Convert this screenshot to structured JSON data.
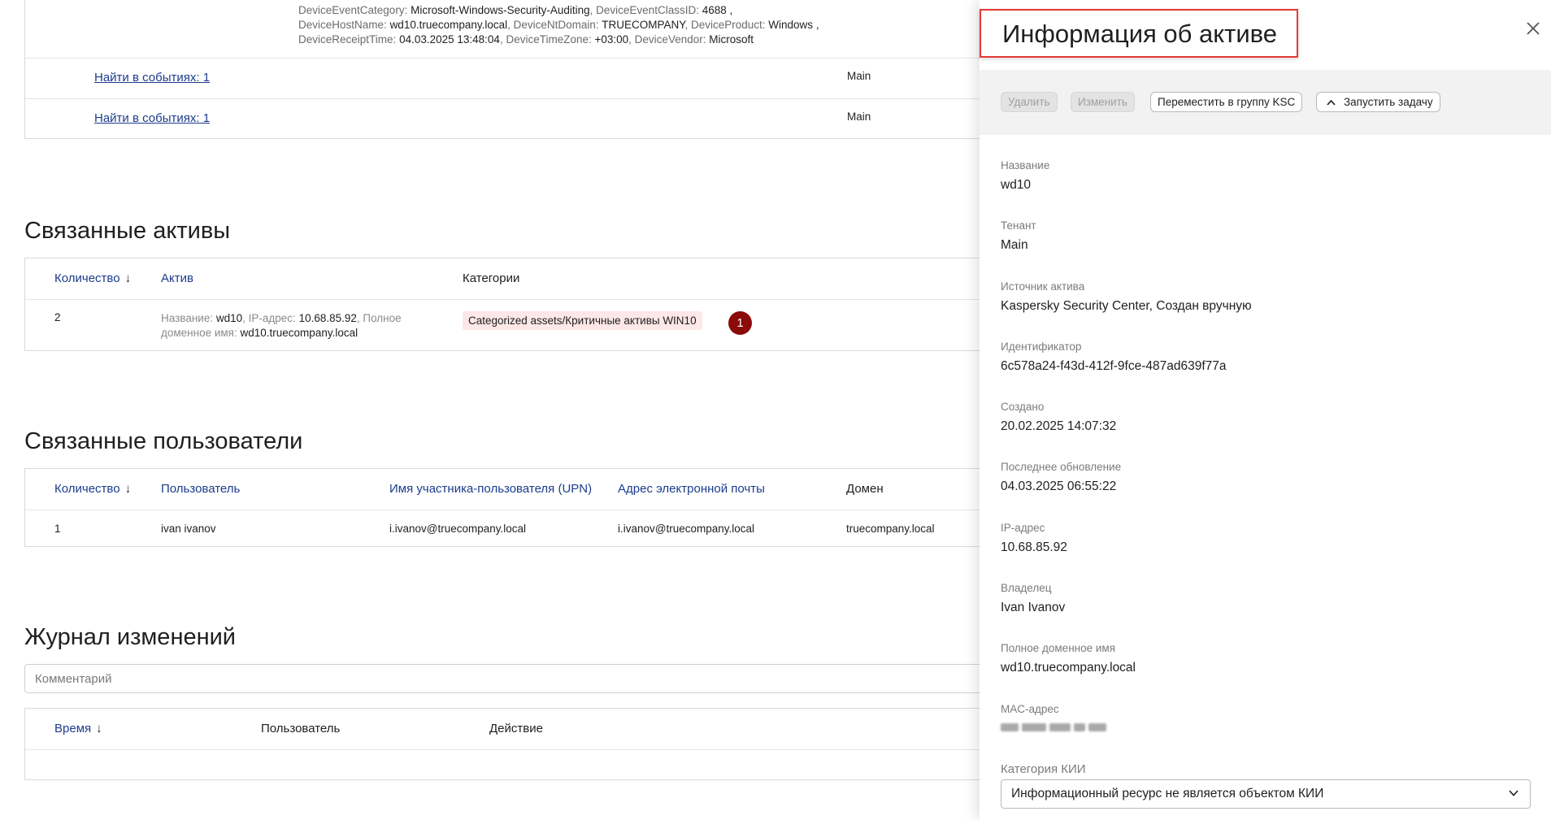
{
  "event_fields": {
    "line1": {
      "k1": "DeviceEventCategory:",
      "v1": "Microsoft-Windows-Security-Auditing",
      "k2": ", DeviceEventClassID:",
      "v2": "4688",
      "end": ","
    },
    "line2": {
      "k1": "DeviceHostName:",
      "v1": "wd10.truecompany.local",
      "k2": ", DeviceNtDomain:",
      "v2": "TRUECOMPANY",
      "k3": ", DeviceProduct:",
      "v3": "Windows",
      "end": ","
    },
    "line3": {
      "k1": "DeviceReceiptTime:",
      "v1": "04.03.2025 13:48:04",
      "k2": ", DeviceTimeZone:",
      "v2": "+03:00",
      "k3": ", DeviceVendor:",
      "v3": "Microsoft"
    }
  },
  "event_links": [
    {
      "link": "Найти в событиях: 1",
      "tenant": "Main"
    },
    {
      "link": "Найти в событиях: 1",
      "tenant": "Main"
    }
  ],
  "related_assets": {
    "title": "Связанные активы",
    "headers": {
      "count": "Количество",
      "asset": "Актив",
      "categories": "Категории"
    },
    "rows": [
      {
        "count": "2",
        "name_label": "Название:",
        "name": "wd10",
        "ip_label": ", IP-адрес:",
        "ip": "10.68.85.92",
        "fqdn_label_1": ", Полное",
        "fqdn_label_2": "доменное имя:",
        "fqdn": "wd10.truecompany.local",
        "category": "Categorized assets/Критичные активы WIN10",
        "badge": "1"
      }
    ]
  },
  "related_users": {
    "title": "Связанные пользователи",
    "headers": {
      "count": "Количество",
      "user": "Пользователь",
      "upn": "Имя участника-пользователя (UPN)",
      "email": "Адрес электронной почты",
      "domain": "Домен"
    },
    "rows": [
      {
        "count": "1",
        "user": "ivan ivanov",
        "upn": "i.ivanov@truecompany.local",
        "email": "i.ivanov@truecompany.local",
        "domain": "truecompany.local"
      }
    ]
  },
  "changelog": {
    "title": "Журнал изменений",
    "comment_placeholder": "Комментарий",
    "headers": {
      "time": "Время",
      "user": "Пользователь",
      "action": "Действие"
    }
  },
  "drawer": {
    "title": "Информация об активе",
    "toolbar": {
      "delete": "Удалить",
      "edit": "Изменить",
      "move": "Переместить в группу KSC",
      "run_task": "Запустить задачу"
    },
    "fields": [
      {
        "label": "Название",
        "value": "wd10"
      },
      {
        "label": "Тенант",
        "value": "Main"
      },
      {
        "label": "Источник актива",
        "value": "Kaspersky Security Center,  Создан вручную"
      },
      {
        "label": "Идентификатор",
        "value": "6c578a24-f43d-412f-9fce-487ad639f77a"
      },
      {
        "label": "Создано",
        "value": "20.02.2025 14:07:32"
      },
      {
        "label": "Последнее обновление",
        "value": "04.03.2025 06:55:22"
      },
      {
        "label": "IP-адрес",
        "value": "10.68.85.92"
      },
      {
        "label": "Владелец",
        "value": "Ivan Ivanov"
      },
      {
        "label": "Полное доменное имя",
        "value": "wd10.truecompany.local"
      }
    ],
    "mac_label": "MAC-адрес",
    "kii_label": "Категория КИИ",
    "kii_value": "Информационный ресурс не является объектом КИИ"
  },
  "colors": {
    "accent_link": "#1b3c8c",
    "badge": "#8b0a0a",
    "tag_bg": "#fde7e7",
    "highlight": "#e53935"
  }
}
